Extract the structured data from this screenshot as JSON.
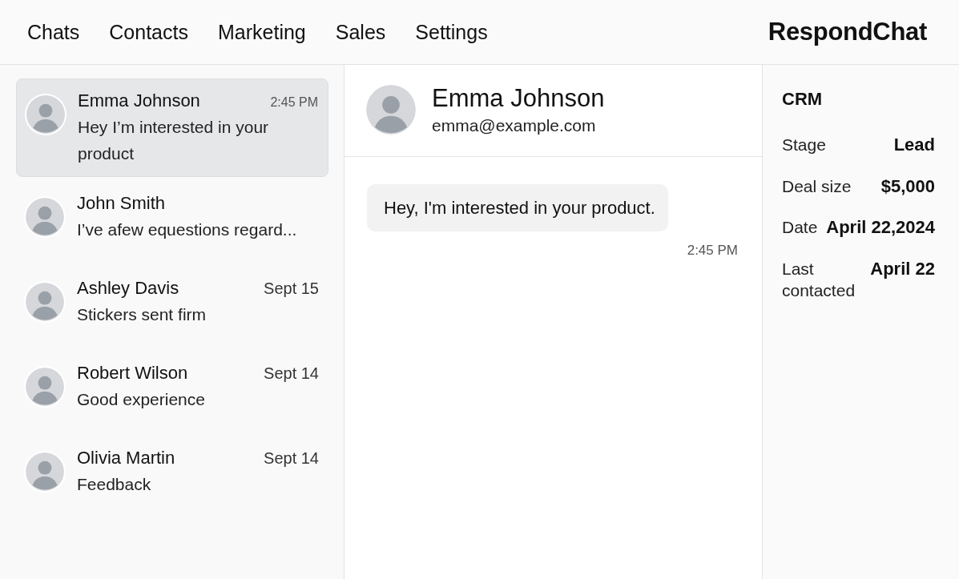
{
  "nav": {
    "items": [
      "Chats",
      "Contacts",
      "Marketing",
      "Sales",
      "Settings"
    ],
    "brand": "RespondChat"
  },
  "chats": [
    {
      "name": "Emma Johnson",
      "time": "2:45 PM",
      "preview": "Hey I’m interested in your product",
      "selected": true
    },
    {
      "name": "John Smith",
      "preview": "I’ve afew equestions regard...",
      "selected": false
    },
    {
      "name": "Ashley Davis",
      "time": "Sept 15",
      "preview": "Stickers sent firm",
      "selected": false
    },
    {
      "name": "Robert Wilson",
      "time": "Sept 14",
      "preview": "Good experience",
      "selected": false
    },
    {
      "name": "Olivia Martin",
      "time": "Sept 14",
      "preview": "Feedback",
      "selected": false
    }
  ],
  "conversation": {
    "name": "Emma Johnson",
    "email": "emma@example.com",
    "messages": [
      {
        "text": "Hey, I'm interested in your product.",
        "time": "2:45 PM"
      }
    ]
  },
  "crm": {
    "title": "CRM",
    "fields": [
      {
        "label": "Stage",
        "value": "Lead"
      },
      {
        "label": "Deal size",
        "value": "$5,000"
      },
      {
        "label": "Date",
        "value": "April 22,2024"
      },
      {
        "label": "Last contacted",
        "value": "April 22"
      }
    ]
  }
}
